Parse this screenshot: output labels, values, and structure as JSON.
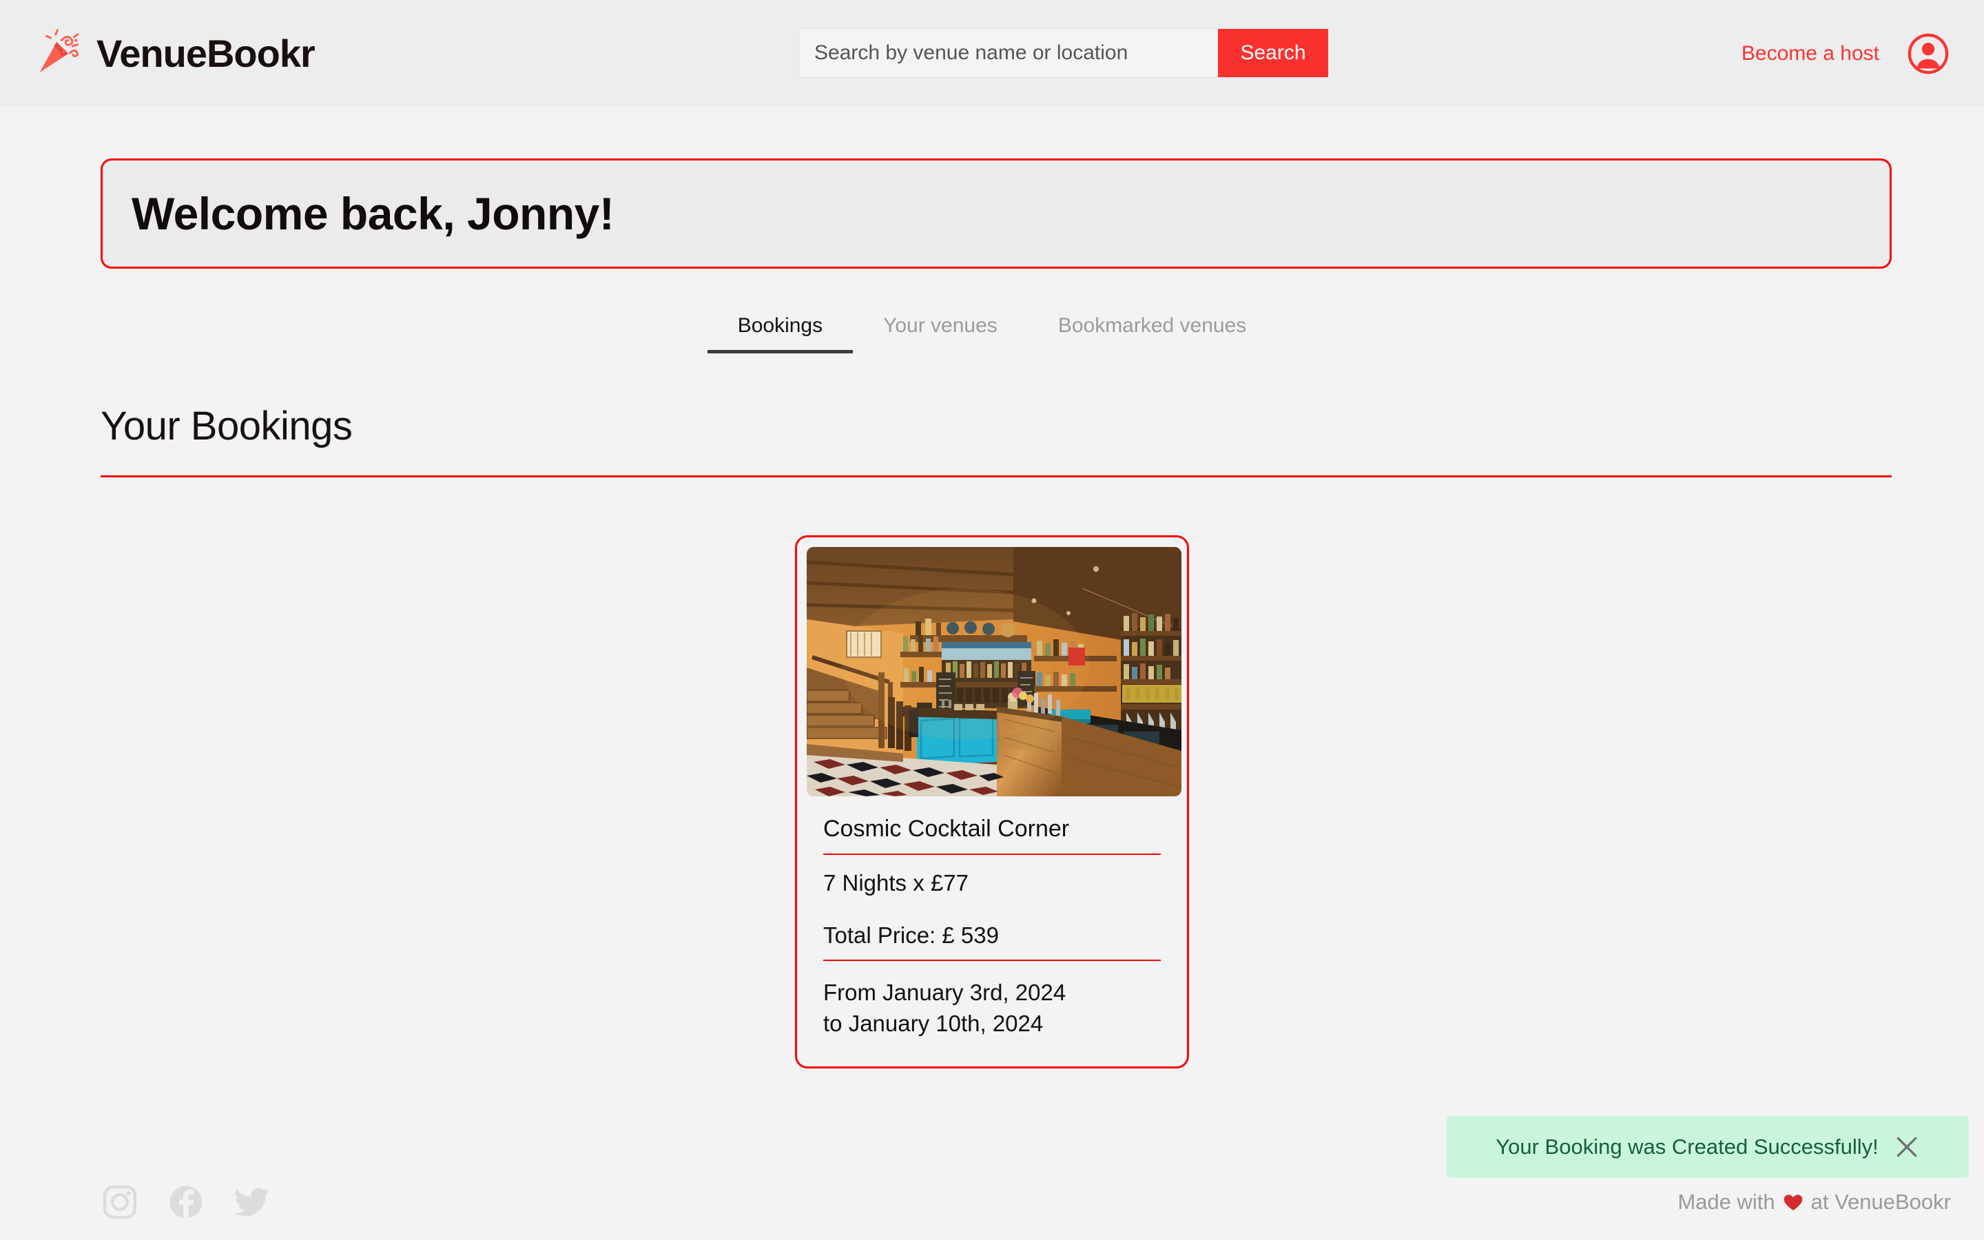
{
  "header": {
    "brand_name": "VenueBookr",
    "logo_icon": "party-popper-icon",
    "search": {
      "placeholder": "Search by venue name or location",
      "value": "",
      "button_label": "Search"
    },
    "become_host_label": "Become a host",
    "avatar_icon": "user-circle-icon"
  },
  "welcome": {
    "message": "Welcome back, Jonny!"
  },
  "tabs": [
    {
      "label": "Bookings",
      "active": true
    },
    {
      "label": "Your venues",
      "active": false
    },
    {
      "label": "Bookmarked venues",
      "active": false
    }
  ],
  "section": {
    "title": "Your Bookings"
  },
  "bookings": [
    {
      "venue_name": "Cosmic Cocktail Corner",
      "nights_line": "7 Nights x £77",
      "total_price_line": "Total Price: £ 539",
      "dates_from": "From January 3rd, 2024",
      "dates_to": "to January 10th, 2024",
      "image_alt": "bar-interior-photo"
    }
  ],
  "toast": {
    "message": "Your Booking was Created Successfully!",
    "close_icon": "close-icon",
    "background_color": "#caf5dd",
    "text_color": "#155e3e"
  },
  "footer": {
    "social": [
      {
        "name": "instagram-icon"
      },
      {
        "name": "facebook-icon"
      },
      {
        "name": "twitter-icon"
      }
    ],
    "made_with_prefix": "Made with",
    "made_with_suffix": "at VenueBookr",
    "heart_icon": "heart-icon"
  },
  "colors": {
    "accent_red": "#f8312f",
    "border_red": "#fa0505",
    "header_bg": "#ededed",
    "body_bg": "#f3f3f3",
    "banner_bg": "#ebebeb",
    "toast_green_bg": "#caf5dd",
    "toast_green_text": "#155e3e"
  }
}
